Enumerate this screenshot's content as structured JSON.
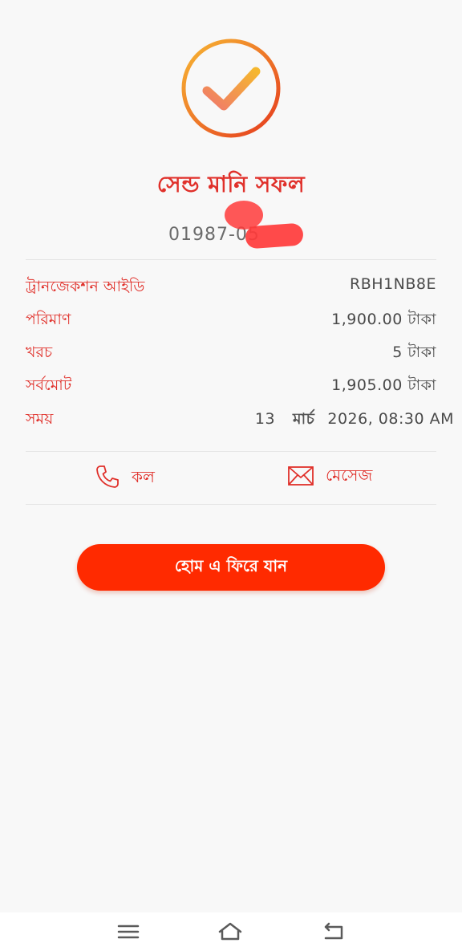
{
  "status": {
    "title": "সেন্ড মানি সফল",
    "recipient_number": "01987-05"
  },
  "details": [
    {
      "label": "ট্রানজেকশন আইডি",
      "value": "RBH1NB8E"
    },
    {
      "label": "পরিমাণ",
      "value": "1,900.00  টাকা"
    },
    {
      "label": "খরচ",
      "value": "5 টাকা"
    },
    {
      "label": "সর্বমোট",
      "value": "1,905.00  টাকা"
    }
  ],
  "time_row": {
    "label": "সময়",
    "day": "13",
    "month": "মার্চ",
    "rest": "2026, 08:30 AM"
  },
  "actions": {
    "call_label": "কল",
    "message_label": "মেসেজ"
  },
  "home_button_label": "হোম এ ফিরে যান",
  "colors": {
    "accent": "#e0302a",
    "button": "#ff2a00",
    "check_gradient_start": "#f7b733",
    "check_gradient_end": "#e53a1e"
  },
  "icons": {
    "success": "checkmark-circle-icon",
    "call": "phone-icon",
    "message": "envelope-icon",
    "nav_menu": "menu-icon",
    "nav_home": "home-icon",
    "nav_back": "back-icon"
  }
}
